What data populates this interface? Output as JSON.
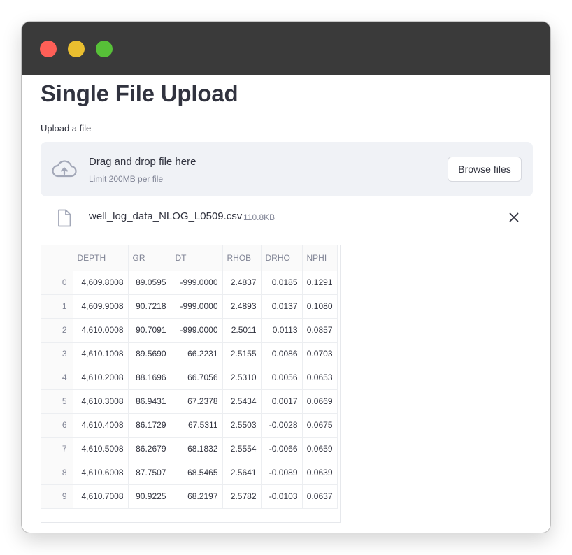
{
  "window": {
    "controls": [
      {
        "name": "close",
        "color": "#fe5f57"
      },
      {
        "name": "minimize",
        "color": "#e9be2f"
      },
      {
        "name": "maximize",
        "color": "#57c038"
      }
    ]
  },
  "page": {
    "title": "Single File Upload"
  },
  "uploader": {
    "label": "Upload a file",
    "drop_text": "Drag and drop file here",
    "limit_text": "Limit 200MB per file",
    "browse_label": "Browse files",
    "icon": "cloud-upload-icon"
  },
  "uploaded_file": {
    "name": "well_log_data_NLOG_L0509.csv",
    "size": "110.8KB",
    "icon": "file-icon",
    "remove_icon": "close-icon"
  },
  "dataframe": {
    "columns": [
      "DEPTH",
      "GR",
      "DT",
      "RHOB",
      "DRHO",
      "NPHI"
    ],
    "rows": [
      [
        "0",
        "4,609.8008",
        "89.0595",
        "-999.0000",
        "2.4837",
        "0.0185",
        "0.1291"
      ],
      [
        "1",
        "4,609.9008",
        "90.7218",
        "-999.0000",
        "2.4893",
        "0.0137",
        "0.1080"
      ],
      [
        "2",
        "4,610.0008",
        "90.7091",
        "-999.0000",
        "2.5011",
        "0.0113",
        "0.0857"
      ],
      [
        "3",
        "4,610.1008",
        "89.5690",
        "66.2231",
        "2.5155",
        "0.0086",
        "0.0703"
      ],
      [
        "4",
        "4,610.2008",
        "88.1696",
        "66.7056",
        "2.5310",
        "0.0056",
        "0.0653"
      ],
      [
        "5",
        "4,610.3008",
        "86.9431",
        "67.2378",
        "2.5434",
        "0.0017",
        "0.0669"
      ],
      [
        "6",
        "4,610.4008",
        "86.1729",
        "67.5311",
        "2.5503",
        "-0.0028",
        "0.0675"
      ],
      [
        "7",
        "4,610.5008",
        "86.2679",
        "68.1832",
        "2.5554",
        "-0.0066",
        "0.0659"
      ],
      [
        "8",
        "4,610.6008",
        "87.7507",
        "68.5465",
        "2.5641",
        "-0.0089",
        "0.0639"
      ],
      [
        "9",
        "4,610.7008",
        "90.9225",
        "68.2197",
        "2.5782",
        "-0.0103",
        "0.0637"
      ]
    ]
  },
  "colors": {
    "titlebar": "#3a3a3a",
    "text": "#31333f",
    "muted": "#808495",
    "dropzone": "#f0f2f6",
    "icon": "#a3a8b8"
  }
}
